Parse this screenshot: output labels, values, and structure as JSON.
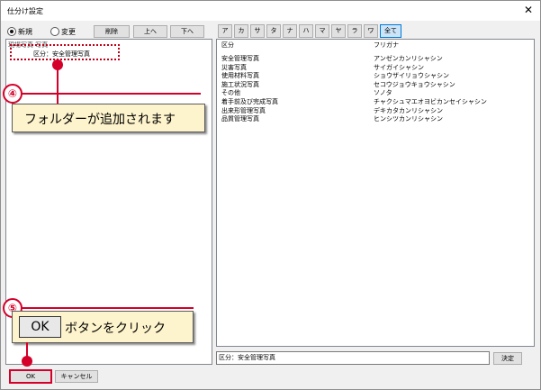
{
  "window": {
    "title": "仕分け設定",
    "close": "✕"
  },
  "mode": {
    "new_label": "新規",
    "change_label": "変更",
    "selected": "new"
  },
  "buttons": {
    "delete": "削除",
    "up": "上へ",
    "down": "下へ",
    "decide": "決定",
    "ok": "OK",
    "cancel": "キャンセル"
  },
  "kana": [
    "ア",
    "カ",
    "サ",
    "タ",
    "ナ",
    "ハ",
    "マ",
    "ヤ",
    "ラ",
    "ワ",
    "全て"
  ],
  "kana_selected": "全て",
  "tree": {
    "root": "現場写真 写真",
    "child": "区分：安全管理写真"
  },
  "table": {
    "headers": [
      "区分",
      "フリガナ"
    ],
    "rows": [
      [
        "安全管理写真",
        "アンゼンカンリシャシン"
      ],
      [
        "災害写真",
        "サイガイシャシン"
      ],
      [
        "使用材料写真",
        "ショウザイリョウシャシン"
      ],
      [
        "施工状況写真",
        "セコウジョウキョウシャシン"
      ],
      [
        "その他",
        "ソノタ"
      ],
      [
        "着手前及び完成写真",
        "チャクシュマエオヨビカンセイシャシン"
      ],
      [
        "出来形管理写真",
        "デキカタカンリシャシン"
      ],
      [
        "品質管理写真",
        "ヒンシツカンリシャシン"
      ]
    ]
  },
  "input_value": "区分：安全管理写真",
  "callouts": {
    "c4": {
      "num": "④",
      "text": "フォルダーが追加されます"
    },
    "c5": {
      "num": "⑤",
      "ok_label": "OK",
      "text": "ボタンをクリック"
    }
  },
  "colors": {
    "accent_red": "#d4002a",
    "callout_bg": "#fdf3cc"
  }
}
